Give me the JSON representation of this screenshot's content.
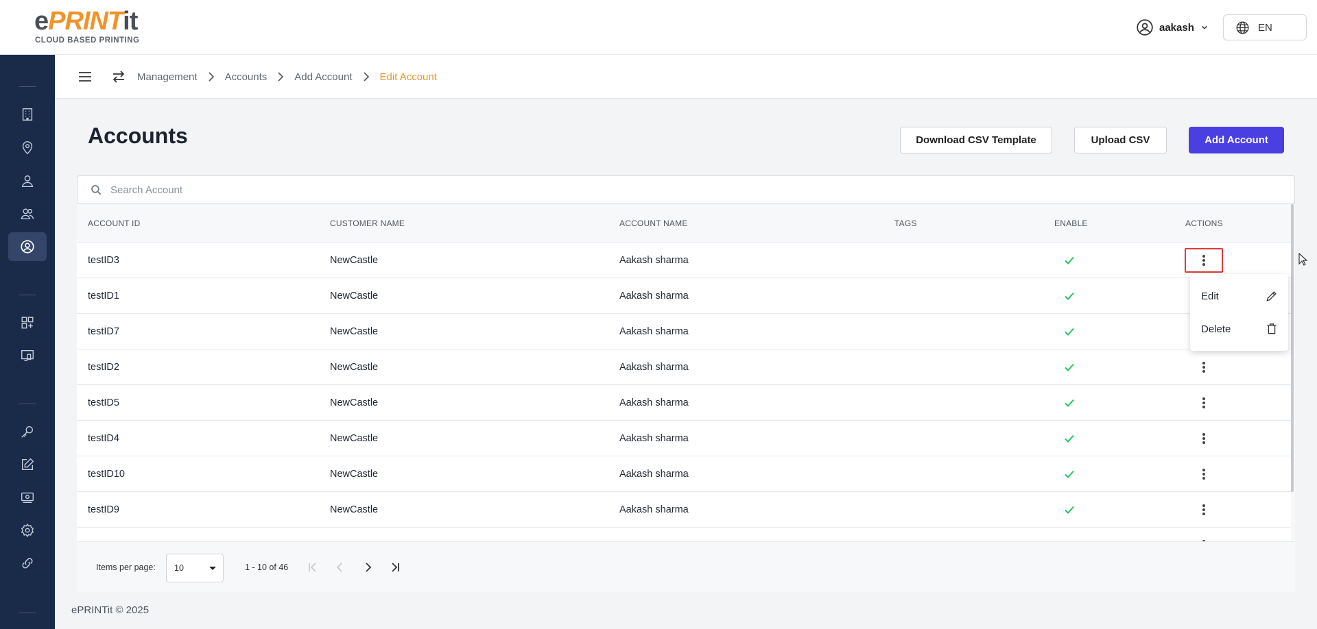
{
  "brand": {
    "logo_prefix": "e",
    "logo_mid": "PRINT",
    "logo_suffix": "it",
    "tagline": "CLOUD BASED PRINTING"
  },
  "header": {
    "username": "aakash",
    "language": "EN"
  },
  "breadcrumb": [
    "Management",
    "Accounts",
    "Add Account",
    "Edit Account"
  ],
  "page": {
    "title": "Accounts",
    "download_csv_label": "Download CSV Template",
    "upload_csv_label": "Upload CSV",
    "add_account_label": "Add Account"
  },
  "search": {
    "placeholder": "Search Account"
  },
  "table": {
    "columns": [
      "ACCOUNT ID",
      "CUSTOMER NAME",
      "ACCOUNT NAME",
      "TAGS",
      "ENABLE",
      "ACTIONS"
    ],
    "rows": [
      {
        "account_id": "testID3",
        "customer": "NewCastle",
        "account_name": "Aakash sharma",
        "tags": "",
        "enabled": true
      },
      {
        "account_id": "testID1",
        "customer": "NewCastle",
        "account_name": "Aakash sharma",
        "tags": "",
        "enabled": true
      },
      {
        "account_id": "testID7",
        "customer": "NewCastle",
        "account_name": "Aakash sharma",
        "tags": "",
        "enabled": true
      },
      {
        "account_id": "testID2",
        "customer": "NewCastle",
        "account_name": "Aakash sharma",
        "tags": "",
        "enabled": true
      },
      {
        "account_id": "testID5",
        "customer": "NewCastle",
        "account_name": "Aakash sharma",
        "tags": "",
        "enabled": true
      },
      {
        "account_id": "testID4",
        "customer": "NewCastle",
        "account_name": "Aakash sharma",
        "tags": "",
        "enabled": true
      },
      {
        "account_id": "testID10",
        "customer": "NewCastle",
        "account_name": "Aakash sharma",
        "tags": "",
        "enabled": true
      },
      {
        "account_id": "testID9",
        "customer": "NewCastle",
        "account_name": "Aakash sharma",
        "tags": "",
        "enabled": true
      }
    ]
  },
  "action_menu": {
    "edit_label": "Edit",
    "delete_label": "Delete"
  },
  "paginator": {
    "items_per_page_label": "Items per page:",
    "page_size": "10",
    "range_label": "1 - 10 of 46"
  },
  "footer": {
    "copyright": "ePRINTit © 2025"
  },
  "colors": {
    "primary": "#4a3fe0",
    "accent_orange": "#f0932b",
    "sidebar_bg": "#1a2b49",
    "enabled_check": "#22c55e",
    "highlight_red": "#e03a3a"
  },
  "icons": {
    "sidebar": [
      "building-icon",
      "location-pin-icon",
      "user-icon",
      "users-icon",
      "account-circle-icon",
      "apps-add-icon",
      "devices-icon",
      "key-icon",
      "edit-note-icon",
      "payment-icon",
      "settings-icon",
      "link-icon"
    ]
  }
}
